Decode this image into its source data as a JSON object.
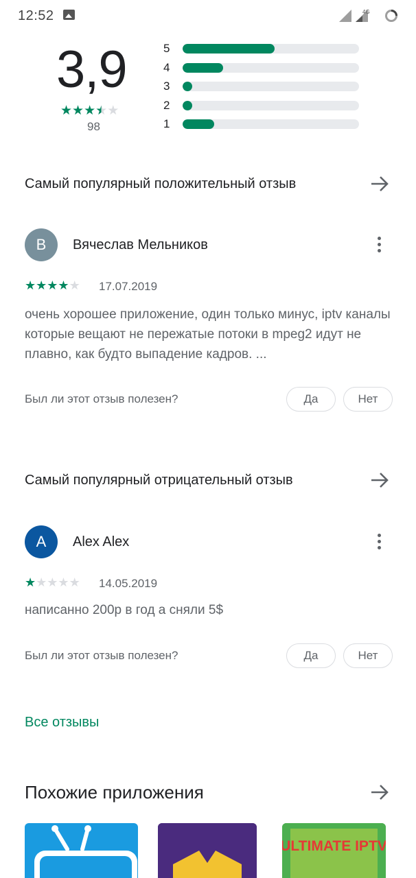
{
  "status_bar": {
    "time": "12:52",
    "network": "4G"
  },
  "rating": {
    "score": "3,9",
    "count": "98",
    "stars": [
      "★",
      "★",
      "★",
      "★",
      "★"
    ],
    "bars": [
      {
        "label": "5",
        "fraction": 0.52
      },
      {
        "label": "4",
        "fraction": 0.23
      },
      {
        "label": "3",
        "fraction": 0.05
      },
      {
        "label": "2",
        "fraction": 0.05
      },
      {
        "label": "1",
        "fraction": 0.18
      }
    ]
  },
  "positive_section": {
    "title": "Самый популярный положительный отзыв",
    "review": {
      "avatar_letter": "В",
      "avatar_color": "#78909c",
      "author": "Вячеслав Мельников",
      "rating": 4,
      "date": "17.07.2019",
      "text": "очень хорошее приложение, один только минус, iptv каналы которые вещают не пережатые потоки в mpeg2 идут не плавно, как будто выпадение кадров. ...",
      "helpful_question": "Был ли этот отзыв полезен?",
      "yes_label": "Да",
      "no_label": "Нет"
    }
  },
  "negative_section": {
    "title": "Самый популярный отрицательный отзыв",
    "review": {
      "avatar_letter": "A",
      "avatar_color": "#0b57a0",
      "author": "Alex Alex",
      "rating": 1,
      "date": "14.05.2019",
      "text": "написанно 200р в год а сняли 5$",
      "helpful_question": "Был ли этот отзыв полезен?",
      "yes_label": "Да",
      "no_label": "Нет"
    }
  },
  "all_reviews_label": "Все отзывы",
  "similar_apps": {
    "title": "Похожие приложения",
    "apps": [
      {
        "name": "tv-app-icon",
        "color": "#1a9be0"
      },
      {
        "name": "video-player-app-icon",
        "color": "#4a2b7e"
      },
      {
        "name": "ultimate-iptv-app-icon",
        "color": "#4caf50",
        "label": "ULTIMATE IPTV"
      }
    ]
  },
  "colors": {
    "accent": "#01875f",
    "track": "#e8eaed"
  }
}
